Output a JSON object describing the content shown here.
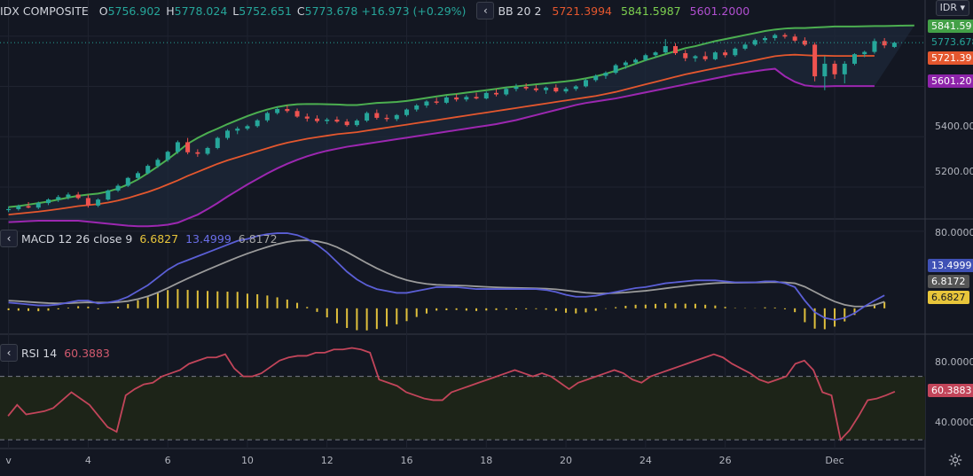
{
  "main_legend": {
    "symbol": "IDX COMPOSITE",
    "o_label": "O",
    "open": "5756.902",
    "h_label": "H",
    "high": "5778.024",
    "l_label": "L",
    "low": "5752.651",
    "c_label": "C",
    "close": "5773.678",
    "change": "+16.973 (+0.29%)",
    "bb_label": "BB 20 2",
    "bb_mid": "5721.3994",
    "bb_upper": "5841.5987",
    "bb_lower": "5601.2000"
  },
  "macd_legend": {
    "label": "MACD 12 26 close 9",
    "hist": "6.6827",
    "macd": "13.4999",
    "signal": "6.8172"
  },
  "rsi_legend": {
    "label": "RSI 14",
    "value": "60.3883"
  },
  "currency": "IDR",
  "price_axis": {
    "ticks": [
      "5200.0000",
      "5400.0000"
    ],
    "tags": {
      "upper": "5841.59",
      "close": "5773.678",
      "mid": "5721.39",
      "lower": "5601.20"
    }
  },
  "macd_axis": {
    "ticks": [
      "80.0000"
    ],
    "tags": {
      "macd": "13.4999",
      "signal": "6.8172",
      "hist": "6.6827"
    }
  },
  "rsi_axis": {
    "ticks": [
      "80.0000",
      "40.0000"
    ],
    "tag": "60.3883"
  },
  "x_axis": {
    "labels": [
      {
        "text": "v",
        "bar": 0
      },
      {
        "text": "4",
        "bar": 8
      },
      {
        "text": "6",
        "bar": 16
      },
      {
        "text": "10",
        "bar": 24
      },
      {
        "text": "12",
        "bar": 32
      },
      {
        "text": "16",
        "bar": 40
      },
      {
        "text": "18",
        "bar": 48
      },
      {
        "text": "20",
        "bar": 56
      },
      {
        "text": "24",
        "bar": 64
      },
      {
        "text": "26",
        "bar": 72
      },
      {
        "text": "Dec",
        "bar": 83
      }
    ]
  },
  "colors": {
    "background": "#131722",
    "grid": "#1f2330",
    "up": "#26a69a",
    "down": "#ef5350",
    "bb_upper": "#4caf50",
    "bb_mid": "#e4572e",
    "bb_lower": "#9c27b0",
    "macd": "#5b5fd6",
    "signal": "#9b9b9b",
    "hist": "#e0c03c",
    "rsi": "#c2455a"
  },
  "chart_data": {
    "type": "candlestick",
    "title": "IDX COMPOSITE",
    "price_range": [
      5080,
      5880
    ],
    "bars": [
      {
        "o": 5108,
        "h": 5122,
        "l": 5100,
        "c": 5112
      },
      {
        "o": 5112,
        "h": 5130,
        "l": 5106,
        "c": 5124
      },
      {
        "o": 5124,
        "h": 5140,
        "l": 5115,
        "c": 5118
      },
      {
        "o": 5118,
        "h": 5142,
        "l": 5112,
        "c": 5136
      },
      {
        "o": 5136,
        "h": 5155,
        "l": 5128,
        "c": 5150
      },
      {
        "o": 5150,
        "h": 5168,
        "l": 5140,
        "c": 5160
      },
      {
        "o": 5160,
        "h": 5178,
        "l": 5150,
        "c": 5170
      },
      {
        "o": 5170,
        "h": 5180,
        "l": 5150,
        "c": 5156
      },
      {
        "o": 5156,
        "h": 5170,
        "l": 5118,
        "c": 5126
      },
      {
        "o": 5126,
        "h": 5155,
        "l": 5120,
        "c": 5150
      },
      {
        "o": 5150,
        "h": 5190,
        "l": 5146,
        "c": 5186
      },
      {
        "o": 5186,
        "h": 5212,
        "l": 5180,
        "c": 5205
      },
      {
        "o": 5205,
        "h": 5240,
        "l": 5200,
        "c": 5236
      },
      {
        "o": 5236,
        "h": 5262,
        "l": 5228,
        "c": 5255
      },
      {
        "o": 5255,
        "h": 5290,
        "l": 5250,
        "c": 5284
      },
      {
        "o": 5284,
        "h": 5315,
        "l": 5276,
        "c": 5308
      },
      {
        "o": 5308,
        "h": 5345,
        "l": 5300,
        "c": 5340
      },
      {
        "o": 5340,
        "h": 5385,
        "l": 5332,
        "c": 5378
      },
      {
        "o": 5378,
        "h": 5395,
        "l": 5330,
        "c": 5338
      },
      {
        "o": 5338,
        "h": 5350,
        "l": 5320,
        "c": 5332
      },
      {
        "o": 5332,
        "h": 5360,
        "l": 5326,
        "c": 5355
      },
      {
        "o": 5355,
        "h": 5400,
        "l": 5350,
        "c": 5395
      },
      {
        "o": 5395,
        "h": 5430,
        "l": 5388,
        "c": 5424
      },
      {
        "o": 5424,
        "h": 5440,
        "l": 5410,
        "c": 5432
      },
      {
        "o": 5432,
        "h": 5448,
        "l": 5425,
        "c": 5442
      },
      {
        "o": 5442,
        "h": 5470,
        "l": 5436,
        "c": 5465
      },
      {
        "o": 5465,
        "h": 5500,
        "l": 5458,
        "c": 5494
      },
      {
        "o": 5494,
        "h": 5518,
        "l": 5488,
        "c": 5510
      },
      {
        "o": 5510,
        "h": 5525,
        "l": 5495,
        "c": 5502
      },
      {
        "o": 5502,
        "h": 5512,
        "l": 5475,
        "c": 5480
      },
      {
        "o": 5480,
        "h": 5492,
        "l": 5460,
        "c": 5472
      },
      {
        "o": 5472,
        "h": 5485,
        "l": 5455,
        "c": 5462
      },
      {
        "o": 5462,
        "h": 5475,
        "l": 5450,
        "c": 5468
      },
      {
        "o": 5468,
        "h": 5480,
        "l": 5455,
        "c": 5460
      },
      {
        "o": 5460,
        "h": 5470,
        "l": 5440,
        "c": 5446
      },
      {
        "o": 5446,
        "h": 5470,
        "l": 5440,
        "c": 5464
      },
      {
        "o": 5464,
        "h": 5500,
        "l": 5458,
        "c": 5494
      },
      {
        "o": 5494,
        "h": 5508,
        "l": 5468,
        "c": 5475
      },
      {
        "o": 5475,
        "h": 5488,
        "l": 5460,
        "c": 5470
      },
      {
        "o": 5470,
        "h": 5490,
        "l": 5462,
        "c": 5486
      },
      {
        "o": 5486,
        "h": 5512,
        "l": 5480,
        "c": 5508
      },
      {
        "o": 5508,
        "h": 5530,
        "l": 5500,
        "c": 5524
      },
      {
        "o": 5524,
        "h": 5545,
        "l": 5515,
        "c": 5540
      },
      {
        "o": 5540,
        "h": 5555,
        "l": 5528,
        "c": 5535
      },
      {
        "o": 5535,
        "h": 5562,
        "l": 5530,
        "c": 5556
      },
      {
        "o": 5556,
        "h": 5570,
        "l": 5540,
        "c": 5548
      },
      {
        "o": 5548,
        "h": 5565,
        "l": 5540,
        "c": 5558
      },
      {
        "o": 5558,
        "h": 5575,
        "l": 5548,
        "c": 5552
      },
      {
        "o": 5552,
        "h": 5580,
        "l": 5548,
        "c": 5574
      },
      {
        "o": 5574,
        "h": 5590,
        "l": 5560,
        "c": 5568
      },
      {
        "o": 5568,
        "h": 5596,
        "l": 5562,
        "c": 5590
      },
      {
        "o": 5590,
        "h": 5610,
        "l": 5580,
        "c": 5598
      },
      {
        "o": 5598,
        "h": 5612,
        "l": 5585,
        "c": 5592
      },
      {
        "o": 5592,
        "h": 5605,
        "l": 5578,
        "c": 5585
      },
      {
        "o": 5585,
        "h": 5600,
        "l": 5570,
        "c": 5595
      },
      {
        "o": 5595,
        "h": 5608,
        "l": 5575,
        "c": 5580
      },
      {
        "o": 5580,
        "h": 5598,
        "l": 5572,
        "c": 5590
      },
      {
        "o": 5590,
        "h": 5605,
        "l": 5582,
        "c": 5600
      },
      {
        "o": 5600,
        "h": 5630,
        "l": 5596,
        "c": 5625
      },
      {
        "o": 5625,
        "h": 5648,
        "l": 5618,
        "c": 5642
      },
      {
        "o": 5642,
        "h": 5660,
        "l": 5630,
        "c": 5654
      },
      {
        "o": 5654,
        "h": 5690,
        "l": 5648,
        "c": 5684
      },
      {
        "o": 5684,
        "h": 5702,
        "l": 5670,
        "c": 5695
      },
      {
        "o": 5695,
        "h": 5712,
        "l": 5688,
        "c": 5706
      },
      {
        "o": 5706,
        "h": 5730,
        "l": 5700,
        "c": 5724
      },
      {
        "o": 5724,
        "h": 5740,
        "l": 5715,
        "c": 5735
      },
      {
        "o": 5735,
        "h": 5788,
        "l": 5730,
        "c": 5760
      },
      {
        "o": 5760,
        "h": 5772,
        "l": 5725,
        "c": 5732
      },
      {
        "o": 5732,
        "h": 5745,
        "l": 5700,
        "c": 5712
      },
      {
        "o": 5712,
        "h": 5725,
        "l": 5698,
        "c": 5720
      },
      {
        "o": 5720,
        "h": 5738,
        "l": 5700,
        "c": 5708
      },
      {
        "o": 5708,
        "h": 5740,
        "l": 5704,
        "c": 5735
      },
      {
        "o": 5735,
        "h": 5745,
        "l": 5715,
        "c": 5724
      },
      {
        "o": 5724,
        "h": 5755,
        "l": 5718,
        "c": 5750
      },
      {
        "o": 5750,
        "h": 5772,
        "l": 5744,
        "c": 5766
      },
      {
        "o": 5766,
        "h": 5790,
        "l": 5760,
        "c": 5784
      },
      {
        "o": 5784,
        "h": 5800,
        "l": 5772,
        "c": 5792
      },
      {
        "o": 5792,
        "h": 5810,
        "l": 5782,
        "c": 5804
      },
      {
        "o": 5804,
        "h": 5812,
        "l": 5790,
        "c": 5798
      },
      {
        "o": 5798,
        "h": 5808,
        "l": 5776,
        "c": 5782
      },
      {
        "o": 5782,
        "h": 5795,
        "l": 5760,
        "c": 5766
      },
      {
        "o": 5766,
        "h": 5775,
        "l": 5620,
        "c": 5640
      },
      {
        "o": 5640,
        "h": 5720,
        "l": 5585,
        "c": 5690
      },
      {
        "o": 5690,
        "h": 5702,
        "l": 5630,
        "c": 5648
      },
      {
        "o": 5648,
        "h": 5700,
        "l": 5612,
        "c": 5690
      },
      {
        "o": 5690,
        "h": 5732,
        "l": 5684,
        "c": 5728
      },
      {
        "o": 5728,
        "h": 5742,
        "l": 5716,
        "c": 5737
      },
      {
        "o": 5737,
        "h": 5790,
        "l": 5730,
        "c": 5780
      },
      {
        "o": 5780,
        "h": 5792,
        "l": 5752,
        "c": 5763
      },
      {
        "o": 5756.902,
        "h": 5778.024,
        "l": 5752.651,
        "c": 5773.678
      }
    ],
    "bb_upper": [
      5120,
      5124,
      5130,
      5136,
      5142,
      5150,
      5158,
      5165,
      5170,
      5174,
      5182,
      5194,
      5210,
      5230,
      5255,
      5282,
      5310,
      5340,
      5372,
      5395,
      5415,
      5432,
      5450,
      5466,
      5482,
      5496,
      5508,
      5518,
      5525,
      5529,
      5530,
      5530,
      5529,
      5528,
      5526,
      5526,
      5530,
      5534,
      5536,
      5538,
      5542,
      5548,
      5554,
      5560,
      5566,
      5570,
      5575,
      5580,
      5585,
      5590,
      5596,
      5600,
      5604,
      5608,
      5612,
      5616,
      5620,
      5625,
      5632,
      5640,
      5650,
      5662,
      5676,
      5690,
      5704,
      5716,
      5728,
      5740,
      5752,
      5760,
      5770,
      5780,
      5788,
      5796,
      5804,
      5812,
      5820,
      5826,
      5830,
      5832,
      5832,
      5834,
      5836,
      5838,
      5838,
      5838,
      5839,
      5840,
      5840,
      5841,
      5841.6,
      5842
    ],
    "bb_mid": [
      5090,
      5094,
      5098,
      5102,
      5107,
      5112,
      5118,
      5124,
      5128,
      5132,
      5138,
      5146,
      5156,
      5168,
      5180,
      5194,
      5210,
      5226,
      5244,
      5260,
      5276,
      5292,
      5306,
      5318,
      5330,
      5342,
      5354,
      5366,
      5376,
      5384,
      5392,
      5398,
      5404,
      5410,
      5414,
      5418,
      5424,
      5430,
      5436,
      5442,
      5448,
      5454,
      5460,
      5466,
      5472,
      5478,
      5484,
      5490,
      5496,
      5502,
      5508,
      5514,
      5520,
      5526,
      5532,
      5538,
      5544,
      5550,
      5556,
      5562,
      5570,
      5578,
      5588,
      5598,
      5608,
      5618,
      5628,
      5638,
      5648,
      5656,
      5664,
      5672,
      5680,
      5688,
      5696,
      5704,
      5712,
      5720,
      5724,
      5726,
      5724,
      5722,
      5722,
      5721,
      5721,
      5721,
      5721.4,
      5721.4
    ],
    "bb_lower": [
      5060,
      5062,
      5064,
      5066,
      5066,
      5066,
      5066,
      5066,
      5062,
      5058,
      5054,
      5050,
      5046,
      5044,
      5044,
      5046,
      5050,
      5058,
      5074,
      5090,
      5112,
      5136,
      5162,
      5186,
      5210,
      5232,
      5254,
      5274,
      5292,
      5308,
      5322,
      5334,
      5344,
      5352,
      5360,
      5366,
      5372,
      5378,
      5384,
      5390,
      5396,
      5402,
      5408,
      5414,
      5420,
      5426,
      5432,
      5438,
      5444,
      5450,
      5458,
      5466,
      5476,
      5486,
      5496,
      5506,
      5516,
      5526,
      5534,
      5540,
      5546,
      5552,
      5560,
      5568,
      5576,
      5584,
      5592,
      5600,
      5608,
      5616,
      5624,
      5632,
      5640,
      5648,
      5654,
      5660,
      5666,
      5670,
      5640,
      5618,
      5604,
      5600,
      5600,
      5601,
      5601,
      5601,
      5601.2,
      5601.2
    ],
    "macd": [
      6,
      5,
      4,
      3,
      3,
      4,
      6,
      8,
      8,
      5,
      6,
      8,
      12,
      18,
      24,
      32,
      40,
      46,
      50,
      54,
      58,
      62,
      66,
      70,
      72,
      75,
      77,
      78,
      78,
      76,
      72,
      66,
      58,
      48,
      38,
      30,
      24,
      20,
      18,
      16,
      16,
      18,
      20,
      22,
      22,
      22,
      21,
      20,
      20,
      20,
      20,
      20,
      20,
      20,
      19,
      17,
      14,
      12,
      12,
      13,
      15,
      17,
      19,
      21,
      22,
      24,
      26,
      27,
      28,
      29,
      29,
      29,
      28,
      27,
      27,
      27,
      28,
      28,
      26,
      22,
      8,
      -4,
      -10,
      -12,
      -10,
      -5,
      2,
      8,
      13.4999
    ],
    "signal": [
      8,
      7.4,
      6.7,
      6,
      5.4,
      5.1,
      5.3,
      5.8,
      6.2,
      6,
      6,
      6.4,
      7.5,
      9.6,
      12.5,
      16.4,
      21.1,
      26.1,
      30.9,
      35.5,
      40,
      44.4,
      48.7,
      52.9,
      56.8,
      60.4,
      63.7,
      66.6,
      68.9,
      70.3,
      70.6,
      69.7,
      67.4,
      63.5,
      58.4,
      52.7,
      46.9,
      41.5,
      36.8,
      32.6,
      29.3,
      27,
      25.4,
      24.4,
      24,
      23.7,
      23.4,
      22.8,
      22.3,
      21.8,
      21.4,
      21.2,
      21,
      20.8,
      20.4,
      19.7,
      18.6,
      17.3,
      16.2,
      15.6,
      15.5,
      15.8,
      16.4,
      17.3,
      18.2,
      19.4,
      20.7,
      22,
      23.2,
      24.3,
      25.3,
      26.1,
      26.5,
      26.6,
      26.7,
      26.8,
      27,
      27.2,
      27,
      26,
      22.4,
      17.1,
      11.7,
      7,
      3.6,
      1.9,
      2,
      3.4,
      6.8172
    ],
    "hist": [
      -2,
      -2.4,
      -2.7,
      -3,
      -2.4,
      -1.1,
      0.7,
      2.2,
      1.8,
      -1,
      0,
      1.6,
      4.5,
      8.4,
      11.5,
      15.6,
      18.9,
      19.9,
      19.1,
      18.5,
      18,
      17.6,
      17.3,
      17.1,
      15.2,
      14.6,
      13.3,
      11.4,
      9.1,
      5.7,
      1.4,
      -3.7,
      -9.4,
      -15.5,
      -20.4,
      -22.7,
      -22.9,
      -21.5,
      -18.8,
      -16.6,
      -13.3,
      -9,
      -5.4,
      -2.4,
      -2,
      -1.7,
      -2.4,
      -2.8,
      -2.3,
      -1.8,
      -1.4,
      -1.2,
      -1,
      -0.8,
      -1.4,
      -2.7,
      -4.6,
      -5.3,
      -4.2,
      -2.6,
      -0.5,
      1.2,
      2.6,
      3.7,
      3.8,
      4.6,
      5.3,
      5,
      4.8,
      4.7,
      3.7,
      2.9,
      1.5,
      0.4,
      0.3,
      0.2,
      1,
      0.8,
      -1,
      -4,
      -14.4,
      -21.1,
      -21.7,
      -19,
      -13.6,
      -6.9,
      0,
      4.6,
      6.6827
    ],
    "macd_range": [
      -25,
      90
    ],
    "rsi": [
      45,
      52,
      46,
      47,
      48,
      50,
      55,
      60,
      56,
      52,
      45,
      38,
      35,
      58,
      62,
      65,
      66,
      70,
      72,
      74,
      78,
      80,
      82,
      82,
      84,
      75,
      70,
      70,
      72,
      76,
      80,
      82,
      83,
      83,
      85,
      85,
      87,
      87,
      88,
      87,
      85,
      68,
      66,
      64,
      60,
      58,
      56,
      55,
      55,
      60,
      62,
      64,
      66,
      68,
      70,
      72,
      74,
      72,
      70,
      72,
      70,
      66,
      62,
      66,
      68,
      70,
      72,
      74,
      72,
      68,
      66,
      70,
      72,
      74,
      76,
      78,
      80,
      82,
      84,
      82,
      78,
      75,
      72,
      68,
      66,
      68,
      70,
      78,
      80,
      74,
      60,
      58,
      30,
      36,
      45,
      55,
      56,
      58,
      60.3883
    ],
    "rsi_range": [
      25,
      95
    ],
    "rsi_bands": [
      70,
      30
    ]
  }
}
